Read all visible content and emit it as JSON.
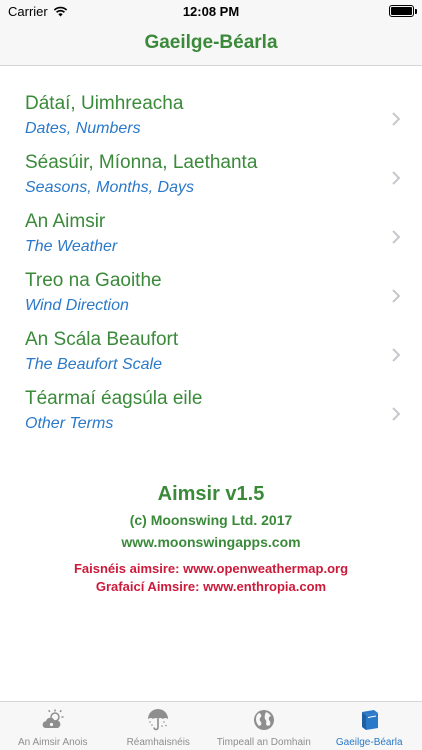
{
  "status": {
    "carrier": "Carrier",
    "time": "12:08 PM"
  },
  "nav": {
    "title": "Gaeilge-Béarla"
  },
  "menu": {
    "items": [
      {
        "title": "Dátaí, Uimhreacha",
        "subtitle": "Dates, Numbers"
      },
      {
        "title": "Séasúir, Míonna, Laethanta",
        "subtitle": "Seasons, Months, Days"
      },
      {
        "title": "An Aimsir",
        "subtitle": "The Weather"
      },
      {
        "title": "Treo na Gaoithe",
        "subtitle": "Wind Direction"
      },
      {
        "title": "An Scála Beaufort",
        "subtitle": "The Beaufort Scale"
      },
      {
        "title": "Téarmaí éagsúla eile",
        "subtitle": "Other Terms"
      }
    ]
  },
  "about": {
    "app_name": "Aimsir v1.5",
    "copyright": "(c) Moonswing Ltd. 2017",
    "website": "www.moonswingapps.com",
    "forecast_credit": "Faisnéis aimsire: www.openweathermap.org",
    "graphics_credit": "Grafaicí Aimsire: www.enthropia.com"
  },
  "tabs": [
    {
      "label": "An Aimsir Anois",
      "icon": "weather-sun-cloud-icon",
      "active": false
    },
    {
      "label": "Réamhaisnéis",
      "icon": "umbrella-icon",
      "active": false
    },
    {
      "label": "Timpeall an Domhain",
      "icon": "globe-icon",
      "active": false
    },
    {
      "label": "Gaeilge-Béarla",
      "icon": "book-icon",
      "active": true
    }
  ],
  "colors": {
    "green": "#3a8a3a",
    "blue": "#2a79c9",
    "red": "#cc1a3a",
    "tab_inactive": "#8e8e8e"
  }
}
